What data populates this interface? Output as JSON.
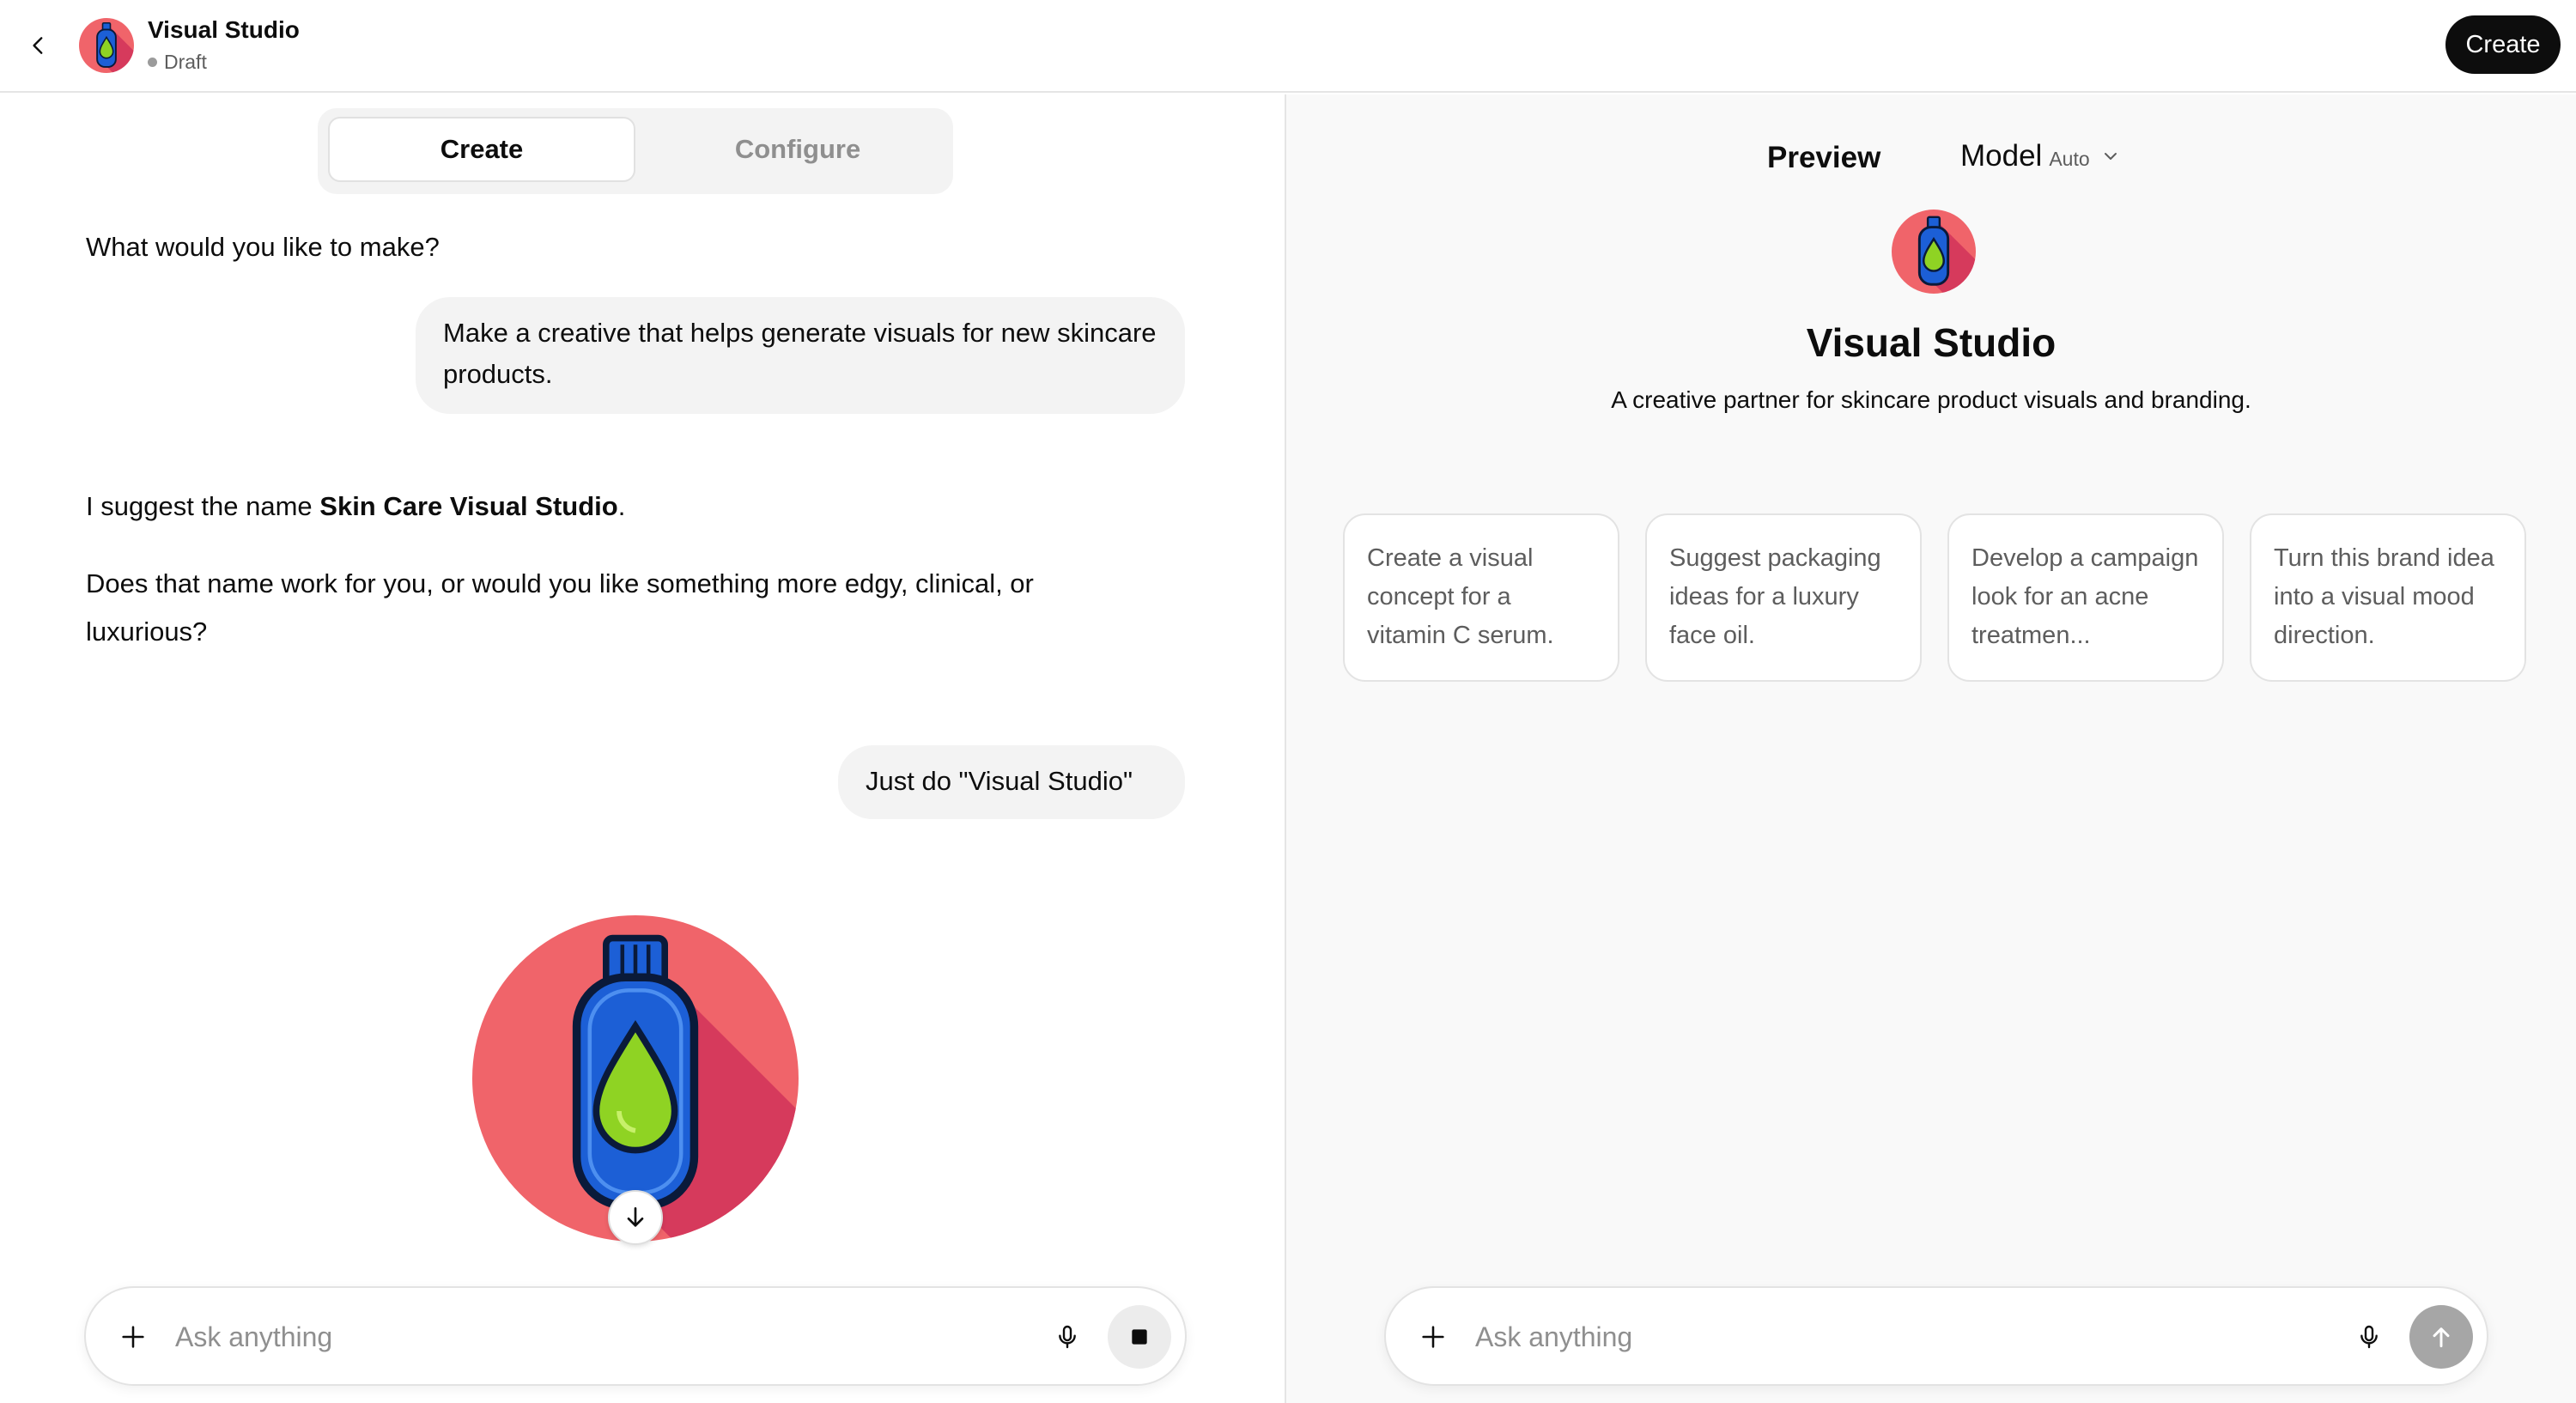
{
  "header": {
    "title": "Visual Studio",
    "status": "Draft",
    "create_label": "Create"
  },
  "tabs": [
    {
      "label": "Create",
      "active": true
    },
    {
      "label": "Configure",
      "active": false
    }
  ],
  "chat": {
    "assistant_1": "What would you like to make?",
    "user_1": "Make a creative that helps generate visuals for new skincare products.",
    "assistant_2_prefix": "I suggest the name ",
    "assistant_2_bold": "Skin Care Visual Studio",
    "assistant_2_suffix": ".",
    "assistant_3": "Does that name work for you, or would you like something more edgy, clinical, or luxurious?",
    "user_2": "Just do \"Visual Studio\""
  },
  "composer_left": {
    "placeholder": "Ask anything"
  },
  "preview": {
    "label": "Preview",
    "model_label": "Model",
    "model_value": "Auto",
    "title": "Visual Studio",
    "description": "A creative partner for skincare product visuals and branding.",
    "starters": [
      "Create a visual concept for a vitamin C serum.",
      "Suggest packaging ideas for a luxury face oil.",
      "Develop a campaign look for an acne treatmen...",
      "Turn this brand idea into a visual mood direction."
    ],
    "composer_placeholder": "Ask anything"
  },
  "colors": {
    "icon_circle": "#f0646a",
    "icon_shadow": "#d63a5c",
    "bottle_blue": "#1c5fd6",
    "drop_green": "#8fd323",
    "send_disabled": "#a6a6a6"
  }
}
